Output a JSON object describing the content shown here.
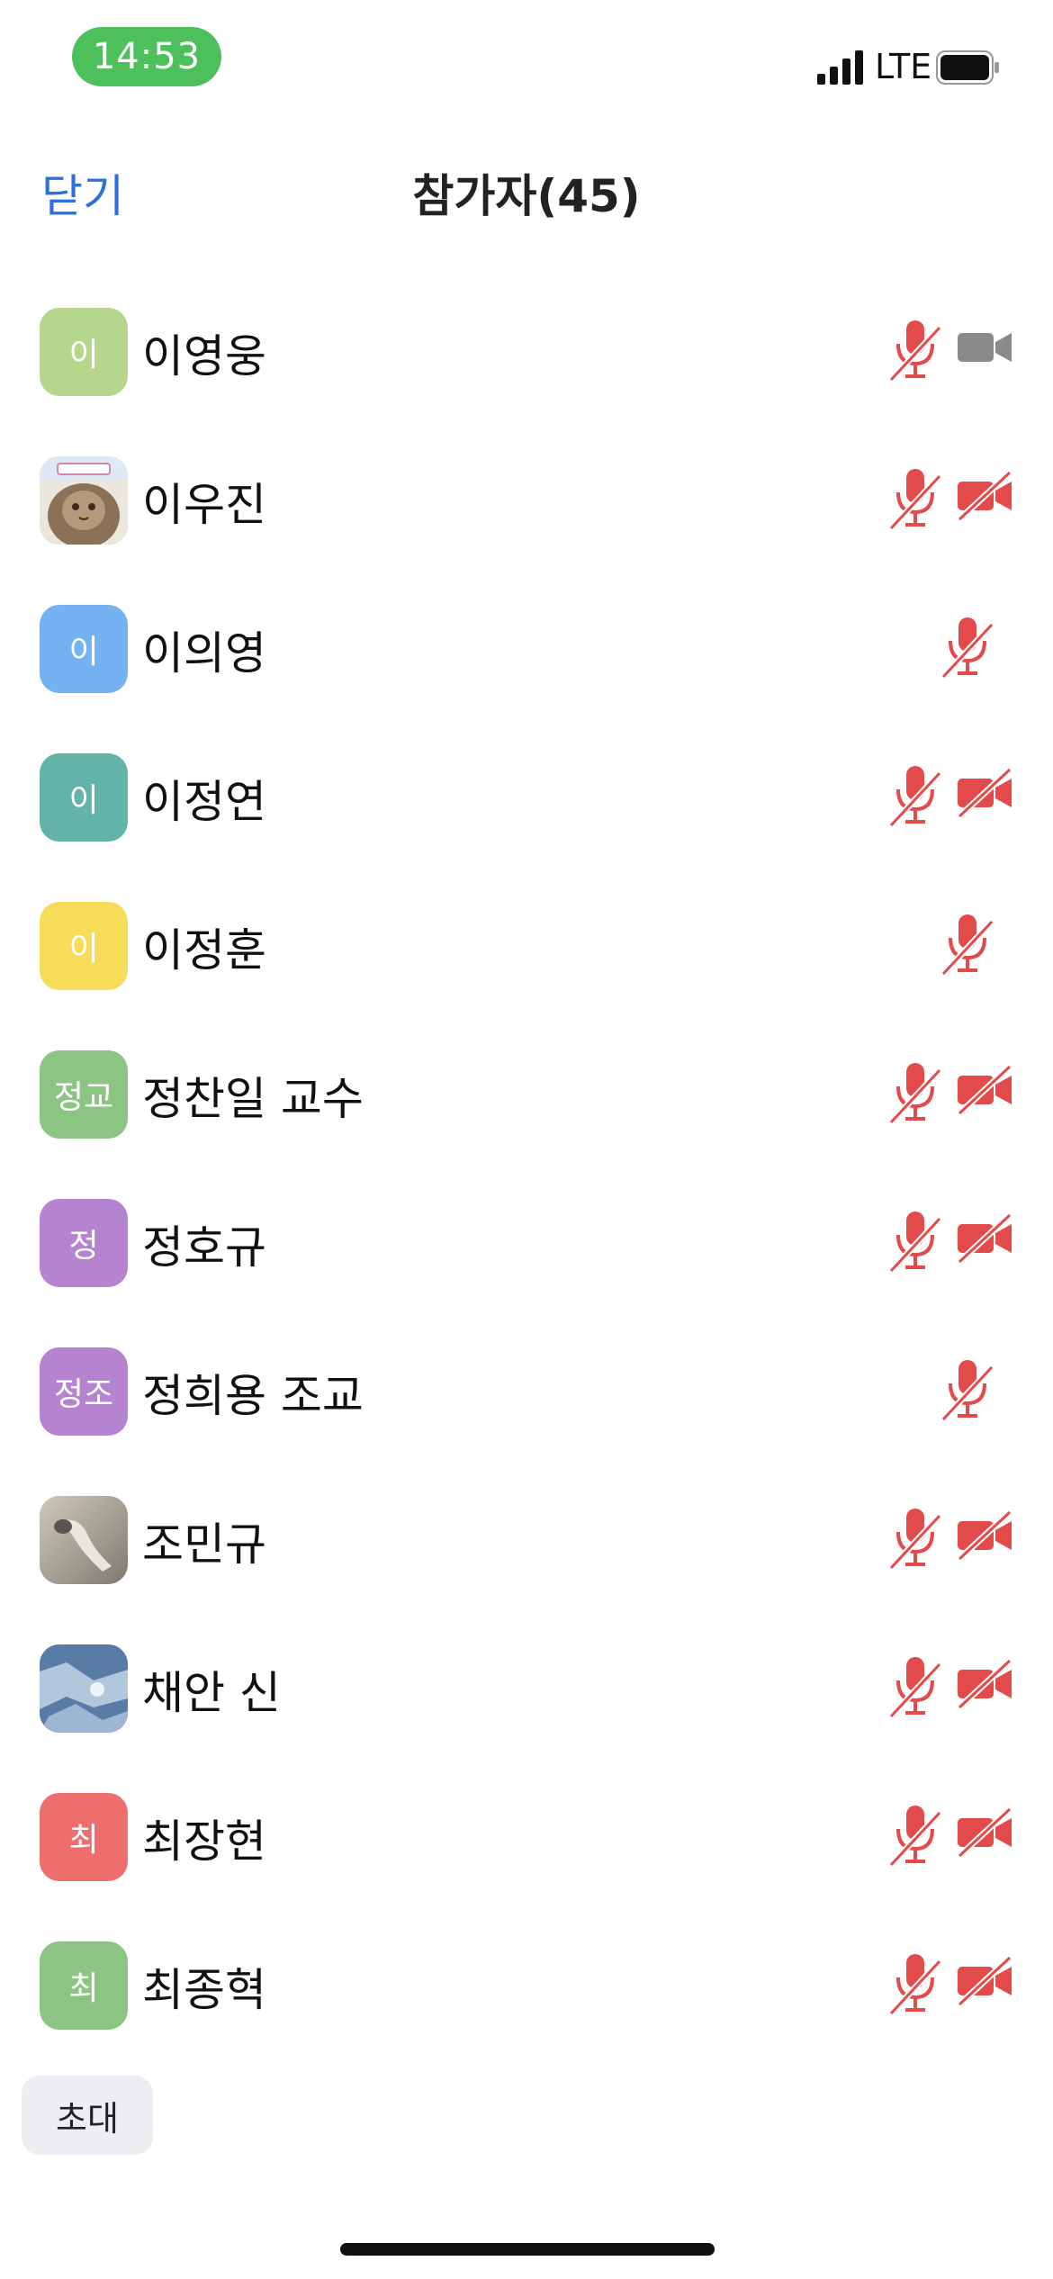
{
  "status_bar": {
    "time": "14:53",
    "network": "LTE"
  },
  "header": {
    "close_label": "닫기",
    "title": "참가자(45)"
  },
  "colors": {
    "accent": "#2f6fdc",
    "muted_red": "#e34a4a",
    "time_pill": "#4dbf5b",
    "camera_on": "#8a8a8a"
  },
  "participants": [
    {
      "name": "이영웅",
      "initial": "이",
      "avatar_color": "#b6d68e",
      "avatar_type": "initial",
      "mic": "muted",
      "camera": "on"
    },
    {
      "name": "이우진",
      "initial": "",
      "avatar_color": "#8c7a63",
      "avatar_type": "photo-cat",
      "mic": "muted",
      "camera": "off"
    },
    {
      "name": "이의영",
      "initial": "이",
      "avatar_color": "#74b2f1",
      "avatar_type": "initial",
      "mic": "muted",
      "camera": "none"
    },
    {
      "name": "이정연",
      "initial": "이",
      "avatar_color": "#63b3a8",
      "avatar_type": "initial",
      "mic": "muted",
      "camera": "off"
    },
    {
      "name": "이정훈",
      "initial": "이",
      "avatar_color": "#f6dc58",
      "avatar_type": "initial",
      "mic": "muted",
      "camera": "none"
    },
    {
      "name": "정찬일 교수",
      "initial": "정교",
      "avatar_color": "#8cc583",
      "avatar_type": "initial",
      "mic": "muted",
      "camera": "off"
    },
    {
      "name": "정호규",
      "initial": "정",
      "avatar_color": "#b583d0",
      "avatar_type": "initial",
      "mic": "muted",
      "camera": "off"
    },
    {
      "name": "정희용 조교",
      "initial": "정조",
      "avatar_color": "#b583d0",
      "avatar_type": "initial",
      "mic": "muted",
      "camera": "none"
    },
    {
      "name": "조민규",
      "initial": "",
      "avatar_color": "#a39f95",
      "avatar_type": "photo-gray",
      "mic": "muted",
      "camera": "off"
    },
    {
      "name": "채안 신",
      "initial": "",
      "avatar_color": "#6f8fb3",
      "avatar_type": "photo-blue",
      "mic": "muted",
      "camera": "off"
    },
    {
      "name": "최장현",
      "initial": "최",
      "avatar_color": "#ee6e6e",
      "avatar_type": "initial",
      "mic": "muted",
      "camera": "off"
    },
    {
      "name": "최종혁",
      "initial": "최",
      "avatar_color": "#8cc583",
      "avatar_type": "initial",
      "mic": "muted",
      "camera": "off"
    }
  ],
  "footer": {
    "invite_label": "초대"
  }
}
